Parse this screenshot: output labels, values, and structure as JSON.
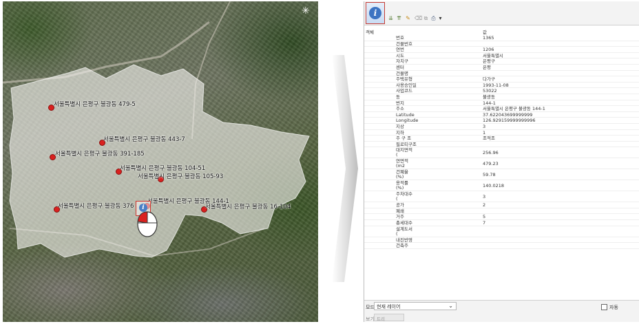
{
  "map": {
    "labels": [
      {
        "text": "서울특별시 은평구 불광동 479-5"
      },
      {
        "text": "서울특별시 은평구 불광동 443-7"
      },
      {
        "text": "서울특별시 은평구 불광동 391-185"
      },
      {
        "text": "서울특별시 은평구 불광동 104-51"
      },
      {
        "text": "서울특별시 은평구 불광동 105-93"
      },
      {
        "text": "서울특별시 은평구 불광동 144-1"
      },
      {
        "text": "서울특별시 은평구 불광동 376"
      },
      {
        "text": "서울특별시 은평구 불광동 16-104"
      }
    ],
    "compass_icon": "north-arrow-icon",
    "identify_icon": "identify-info-icon"
  },
  "panel": {
    "toolbar": {
      "identify_tool_icon": "info-identify-icon",
      "identify_tool_glyph": "i",
      "icons": [
        "expand-tree-icon",
        "collapse-tree-icon",
        "highlight-icon",
        "clear-icon",
        "copy-icon",
        "print-icon",
        "view-dropdown-icon"
      ],
      "icon_glyphs": [
        "⇊",
        "⇈",
        "✎",
        "⌫",
        "⧉",
        "⎙",
        "▾"
      ]
    },
    "header": {
      "feature_col": "객체",
      "value_col": "값"
    },
    "rows": [
      {
        "key": "번호",
        "value": "1365"
      },
      {
        "key": "건물번호",
        "value": ""
      },
      {
        "key": "연번",
        "value": "1206"
      },
      {
        "key": "시도",
        "value": "서울특별시"
      },
      {
        "key": "자치구",
        "value": "은평구"
      },
      {
        "key": "센터",
        "value": "은평"
      },
      {
        "key": "건물명",
        "value": ""
      },
      {
        "key": "주택유형",
        "value": "다가구"
      },
      {
        "key": "사용승인일",
        "value": "1993-11-08"
      },
      {
        "key": "사업코드",
        "value": "53022"
      },
      {
        "key": "동",
        "value": "불광동"
      },
      {
        "key": "번지",
        "value": "144-1"
      },
      {
        "key": "주소",
        "value": "서울특별시 은평구 불광동 144-1"
      },
      {
        "key": "Latitude",
        "value": "37.622043699999999"
      },
      {
        "key": "Longitude",
        "value": "126.929159999999996"
      },
      {
        "key": "지상",
        "value": "3"
      },
      {
        "key": "지하",
        "value": "1"
      },
      {
        "key": "주 구 조",
        "value": "조적조"
      },
      {
        "key": "필로티구조",
        "value": ""
      },
      {
        "key": "대지면적\n(",
        "value": "256.96"
      },
      {
        "key": "연면적\n(m2",
        "value": "479.23"
      },
      {
        "key": "건폐율\n(%)",
        "value": "59.78"
      },
      {
        "key": "용적률\n(%)",
        "value": "140.0218"
      },
      {
        "key": "주차대수\n(",
        "value": "3"
      },
      {
        "key": "공가",
        "value": "2"
      },
      {
        "key": "폐쇄",
        "value": ""
      },
      {
        "key": "거주",
        "value": "5"
      },
      {
        "key": "총세대수",
        "value": "7"
      },
      {
        "key": "설계도서\n(",
        "value": ""
      },
      {
        "key": "내진반영",
        "value": ""
      },
      {
        "key": "건축주",
        "value": ""
      }
    ],
    "footer": {
      "mode_label": "모드",
      "mode_value": "현재 레이어",
      "mode_chevron": "⌄",
      "view_label": "보기",
      "view_value": "트리",
      "auto_label": "자동"
    }
  }
}
